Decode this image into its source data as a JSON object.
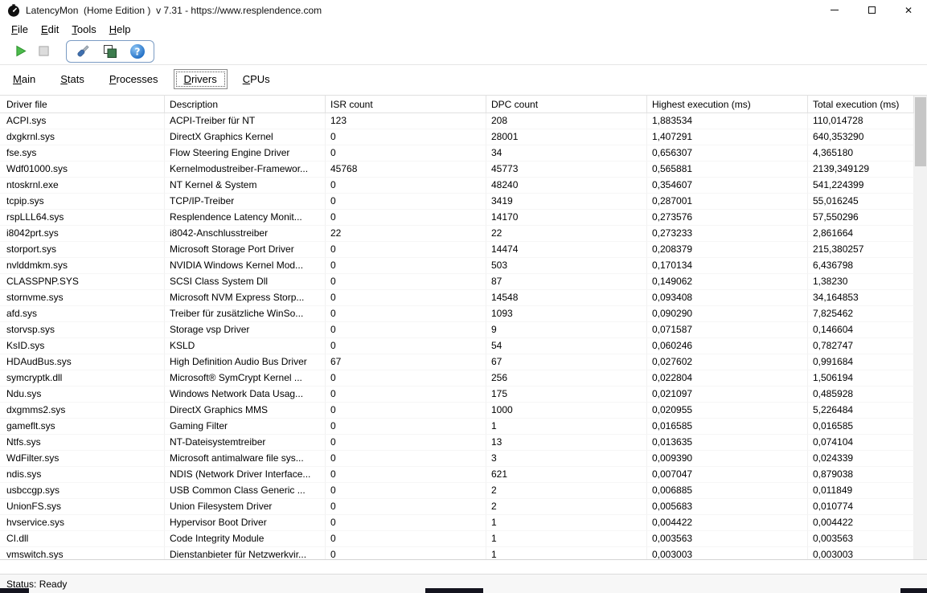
{
  "window": {
    "title": "LatencyMon  (Home Edition )  v 7.31 - https://www.resplendence.com",
    "close_glyph": "✕"
  },
  "menu": {
    "items": [
      "File",
      "Edit",
      "Tools",
      "Help"
    ]
  },
  "toolbar": {
    "help_glyph": "?",
    "buttons": [
      {
        "name": "start-monitor",
        "icon": "play-icon",
        "color": "#35b44a"
      },
      {
        "name": "stop-monitor",
        "icon": "stop-icon",
        "color": "#d9d9d9"
      },
      {
        "name": "driver-tools",
        "icon": "screwdriver-icon"
      },
      {
        "name": "copy-report",
        "icon": "copy-pages-icon"
      },
      {
        "name": "help",
        "icon": "help-icon",
        "color": "#1565c0"
      }
    ]
  },
  "tabs": {
    "active": "Drivers",
    "items": [
      "Main",
      "Stats",
      "Processes",
      "Drivers",
      "CPUs"
    ]
  },
  "table": {
    "columns": [
      "Driver file",
      "Description",
      "ISR count",
      "DPC count",
      "Highest execution (ms)",
      "Total execution (ms)"
    ],
    "rows": [
      [
        "ACPI.sys",
        "ACPI-Treiber für NT",
        "123",
        "208",
        "1,883534",
        "110,014728"
      ],
      [
        "dxgkrnl.sys",
        "DirectX Graphics Kernel",
        "0",
        "28001",
        "1,407291",
        "640,353290"
      ],
      [
        "fse.sys",
        "Flow Steering Engine Driver",
        "0",
        "34",
        "0,656307",
        "4,365180"
      ],
      [
        "Wdf01000.sys",
        "Kernelmodustreiber-Framewor...",
        "45768",
        "45773",
        "0,565881",
        "2139,349129"
      ],
      [
        "ntoskrnl.exe",
        "NT Kernel & System",
        "0",
        "48240",
        "0,354607",
        "541,224399"
      ],
      [
        "tcpip.sys",
        "TCP/IP-Treiber",
        "0",
        "3419",
        "0,287001",
        "55,016245"
      ],
      [
        "rspLLL64.sys",
        "Resplendence Latency Monit...",
        "0",
        "14170",
        "0,273576",
        "57,550296"
      ],
      [
        "i8042prt.sys",
        "i8042-Anschlusstreiber",
        "22",
        "22",
        "0,273233",
        "2,861664"
      ],
      [
        "storport.sys",
        "Microsoft Storage Port Driver",
        "0",
        "14474",
        "0,208379",
        "215,380257"
      ],
      [
        "nvlddmkm.sys",
        "NVIDIA Windows Kernel Mod...",
        "0",
        "503",
        "0,170134",
        "6,436798"
      ],
      [
        "CLASSPNP.SYS",
        "SCSI Class System Dll",
        "0",
        "87",
        "0,149062",
        "1,38230"
      ],
      [
        "stornvme.sys",
        "Microsoft NVM Express Storp...",
        "0",
        "14548",
        "0,093408",
        "34,164853"
      ],
      [
        "afd.sys",
        "Treiber für zusätzliche WinSo...",
        "0",
        "1093",
        "0,090290",
        "7,825462"
      ],
      [
        "storvsp.sys",
        "Storage vsp Driver",
        "0",
        "9",
        "0,071587",
        "0,146604"
      ],
      [
        "KsID.sys",
        "KSLD",
        "0",
        "54",
        "0,060246",
        "0,782747"
      ],
      [
        "HDAudBus.sys",
        "High Definition Audio Bus Driver",
        "67",
        "67",
        "0,027602",
        "0,991684"
      ],
      [
        "symcryptk.dll",
        "Microsoft® SymCrypt Kernel ...",
        "0",
        "256",
        "0,022804",
        "1,506194"
      ],
      [
        "Ndu.sys",
        "Windows Network Data Usag...",
        "0",
        "175",
        "0,021097",
        "0,485928"
      ],
      [
        "dxgmms2.sys",
        "DirectX Graphics MMS",
        "0",
        "1000",
        "0,020955",
        "5,226484"
      ],
      [
        "gameflt.sys",
        "Gaming Filter",
        "0",
        "1",
        "0,016585",
        "0,016585"
      ],
      [
        "Ntfs.sys",
        "NT-Dateisystemtreiber",
        "0",
        "13",
        "0,013635",
        "0,074104"
      ],
      [
        "WdFilter.sys",
        "Microsoft antimalware file sys...",
        "0",
        "3",
        "0,009390",
        "0,024339"
      ],
      [
        "ndis.sys",
        "NDIS (Network Driver Interface...",
        "0",
        "621",
        "0,007047",
        "0,879038"
      ],
      [
        "usbccgp.sys",
        "USB Common Class Generic ...",
        "0",
        "2",
        "0,006885",
        "0,011849"
      ],
      [
        "UnionFS.sys",
        "Union Filesystem Driver",
        "0",
        "2",
        "0,005683",
        "0,010774"
      ],
      [
        "hvservice.sys",
        "Hypervisor Boot Driver",
        "0",
        "1",
        "0,004422",
        "0,004422"
      ],
      [
        "CI.dll",
        "Code Integrity Module",
        "0",
        "1",
        "0,003563",
        "0,003563"
      ],
      [
        "vmswitch.sys",
        "Dienstanbieter für Netzwerkvir...",
        "0",
        "1",
        "0,003003",
        "0,003003"
      ]
    ]
  },
  "status": {
    "text": "Status: Ready"
  }
}
